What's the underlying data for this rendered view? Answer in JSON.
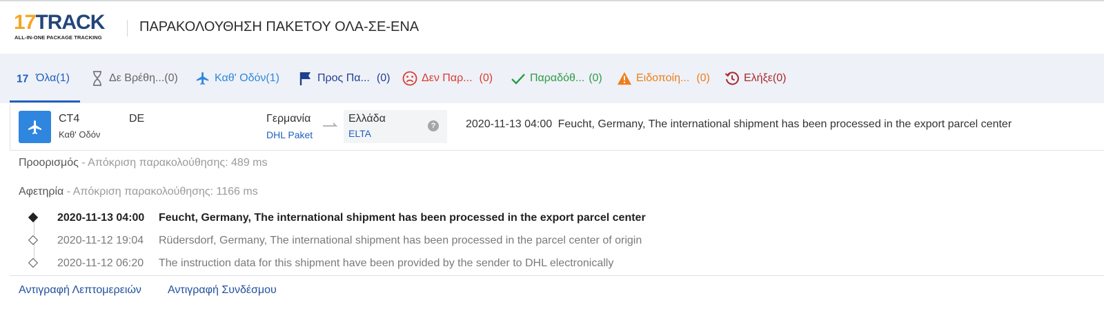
{
  "header": {
    "logo_main_17": "17",
    "logo_main_track": "TRACK",
    "logo_sub": "ALL-IN-ONE PACKAGE TRACKING",
    "title": "ΠΑΡΑΚΟΛΟΥΘΗΣΗ ΠΑΚΕΤΟΥ ΟΛΑ-ΣΕ-ΕΝΑ"
  },
  "tabs": [
    {
      "label": "Όλα(1)",
      "icon": "17-logo-icon",
      "color": "#1f5fbf",
      "active": true
    },
    {
      "label": "Δε Βρέθη...(0)",
      "icon": "hourglass-icon",
      "color": "#666666"
    },
    {
      "label": "Καθ' Οδόν(1)",
      "icon": "plane-icon",
      "color": "#2e86de"
    },
    {
      "label": "Προς Πα...",
      "count": "(0)",
      "icon": "flag-icon",
      "color": "#1f3f8f"
    },
    {
      "label": "Δεν Παρ...",
      "count": "(0)",
      "icon": "sad-face-icon",
      "color": "#d93b30"
    },
    {
      "label": "Παραδόθ...",
      "count": "(0)",
      "icon": "check-icon",
      "color": "#2e9b45"
    },
    {
      "label": "Ειδοποίη...",
      "count": "(0)",
      "icon": "warning-icon",
      "color": "#ef7d1a"
    },
    {
      "label": "Ελήξε(0)",
      "icon": "history-icon",
      "color": "#a8282b"
    }
  ],
  "package": {
    "number_prefix": "CT4",
    "number_suffix": "DE",
    "status": "Καθ' Οδόν",
    "origin_country": "Γερμανία",
    "origin_carrier": "DHL Paket",
    "dest_country": "Ελλάδα",
    "dest_carrier": "ELTA",
    "help": "?",
    "latest_time": "2020-11-13 04:00",
    "latest_desc": "Feucht, Germany, The international shipment has been processed in the export parcel center"
  },
  "details": {
    "destination_label": "Προορισμός",
    "destination_meta": " - Απόκριση παρακολούθησης: 489 ms",
    "origin_label": "Αφετηρία",
    "origin_meta": " - Απόκριση παρακολούθησης: 1166 ms",
    "events": [
      {
        "time": "2020-11-13 04:00",
        "desc": "Feucht, Germany, The international shipment has been processed in the export parcel center",
        "latest": true
      },
      {
        "time": "2020-11-12 19:04",
        "desc": "Rüdersdorf, Germany, The international shipment has been processed in the parcel center of origin",
        "latest": false
      },
      {
        "time": "2020-11-12 06:20",
        "desc": "The instruction data for this shipment have been provided by the sender to DHL electronically",
        "latest": false
      }
    ]
  },
  "footer": {
    "copy_details": "Αντιγραφή Λεπτομερειών",
    "copy_link": "Αντιγραφή Συνδέσμου"
  }
}
